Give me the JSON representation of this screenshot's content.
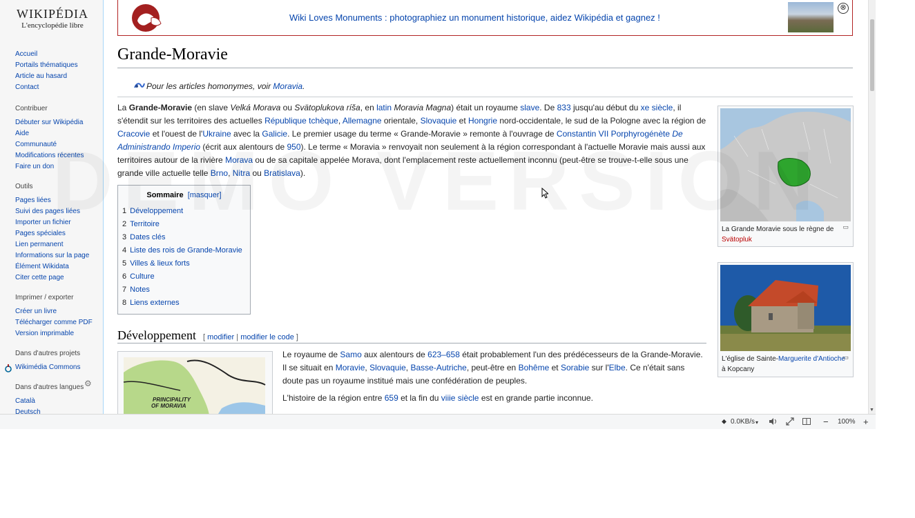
{
  "sidebar": {
    "logo_title": "WIKIPÉDIA",
    "logo_subtitle": "L'encyclopédie libre",
    "nav": [
      "Accueil",
      "Portails thématiques",
      "Article au hasard",
      "Contact"
    ],
    "contribuer": {
      "heading": "Contribuer",
      "items": [
        "Débuter sur Wikipédia",
        "Aide",
        "Communauté",
        "Modifications récentes",
        "Faire un don"
      ]
    },
    "outils": {
      "heading": "Outils",
      "items": [
        "Pages liées",
        "Suivi des pages liées",
        "Importer un fichier",
        "Pages spéciales",
        "Lien permanent",
        "Informations sur la page",
        "Élément Wikidata",
        "Citer cette page"
      ]
    },
    "imprimer": {
      "heading": "Imprimer / exporter",
      "items": [
        "Créer un livre",
        "Télécharger comme PDF",
        "Version imprimable"
      ]
    },
    "projets": {
      "heading": "Dans d'autres projets",
      "items": [
        "Wikimédia Commons"
      ]
    },
    "langues": {
      "heading": "Dans d'autres langues",
      "items": [
        "Català",
        "Deutsch"
      ]
    }
  },
  "banner": {
    "text": "Wiki Loves Monuments : photographiez un monument historique, aidez Wikipédia et gagnez !",
    "close": "⊗"
  },
  "article": {
    "title": "Grande-Moravie",
    "homonym_prefix": "Pour les articles homonymes, voir ",
    "homonym_link": "Moravia",
    "homonym_suffix": "."
  },
  "intro": {
    "t1": "La ",
    "b1": "Grande-Moravie",
    "t2": " (en slave ",
    "i1": "Velká Morava",
    "t3": " ou ",
    "i2": "Svätoplukova ríša",
    "t4": ", en ",
    "l1": "latin",
    "t5": " ",
    "i3": "Moravia Magna",
    "t6": ") était un royaume ",
    "l2": "slave",
    "t7": ". De ",
    "l3": "833",
    "t8": " jusqu'au début du ",
    "l4": "xe siècle",
    "t9": ", il s'étendit sur les territoires des actuelles ",
    "l5": "République tchèque",
    "t10": ", ",
    "l6": "Allemagne",
    "t11": " orientale, ",
    "l7": "Slovaquie",
    "t12": " et ",
    "l8": "Hongrie",
    "t13": " nord-occidentale, le sud de la Pologne avec la région de ",
    "l9": "Cracovie",
    "t14": " et l'ouest de l'",
    "l10": "Ukraine",
    "t15": " avec la ",
    "l11": "Galicie",
    "t16": ". Le premier usage du terme « Grande-Moravie » remonte à l'ouvrage de ",
    "l12": "Constantin VII Porphyrogénète",
    "t17": " ",
    "l13": "De Administrando Imperio",
    "t18": " (écrit aux alentours de ",
    "l14": "950",
    "t19": "). Le terme « Moravia » renvoyait non seulement à la région correspondant à l'actuelle Moravie mais aussi aux territoires autour de la rivière ",
    "l15": "Morava",
    "t20": " ou de sa capitale appelée Morava, dont l'emplacement reste actuellement inconnu (peut-être se trouve-t-elle sous une grande ville actuelle telle ",
    "l16": "Brno",
    "t21": ", ",
    "l17": "Nitra",
    "t22": " ou ",
    "l18": "Bratislava",
    "t23": ")."
  },
  "toc": {
    "title": "Sommaire",
    "toggle": "[masquer]",
    "items": [
      {
        "n": "1",
        "label": "Développement"
      },
      {
        "n": "2",
        "label": "Territoire"
      },
      {
        "n": "3",
        "label": "Dates clés"
      },
      {
        "n": "4",
        "label": "Liste des rois de Grande-Moravie"
      },
      {
        "n": "5",
        "label": "Villes & lieux forts"
      },
      {
        "n": "6",
        "label": "Culture"
      },
      {
        "n": "7",
        "label": "Notes"
      },
      {
        "n": "8",
        "label": "Liens externes"
      }
    ]
  },
  "section": {
    "title": "Développement",
    "edit_open": "[ ",
    "edit1": "modifier",
    "edit_sep": " | ",
    "edit2": "modifier le code",
    "edit_close": " ]"
  },
  "dev": {
    "p1_t1": "Le royaume de ",
    "p1_l1": "Samo",
    "p1_t2": " aux alentours de ",
    "p1_l2": "623–658",
    "p1_t3": " était probablement l'un des prédécesseurs de la Grande-Moravie. Il se situait en ",
    "p1_l3": "Moravie",
    "p1_t4": ", ",
    "p1_l4": "Slovaquie",
    "p1_t5": ", ",
    "p1_l5": "Basse-Autriche",
    "p1_t6": ", peut-être en ",
    "p1_l6": "Bohême",
    "p1_t7": " et ",
    "p1_l7": "Sorabie",
    "p1_t8": " sur l'",
    "p1_l8": "Elbe",
    "p1_t9": ". Ce n'était sans doute pas un royaume institué mais une confédération de peuples.",
    "p2_t1": "L'histoire de la région entre ",
    "p2_l1": "659",
    "p2_t2": " et la fin du ",
    "p2_l2": "viiie siècle",
    "p2_t3": " est en grande partie inconnue."
  },
  "map_thumb": {
    "label_line1": "PRINCIPALITY",
    "label_line2": "OF MORAVIA"
  },
  "infobox": {
    "map_caption_t": "La Grande Moravie sous le règne de ",
    "map_caption_l": "Svätopluk",
    "church_caption_t1": "L'église de Sainte-",
    "church_caption_l1": "Marguerite d'Antioche",
    "church_caption_t2": " à Kopcany"
  },
  "statusbar": {
    "speed": "0.0KB/s",
    "zoom_minus": "−",
    "zoom": "100%",
    "zoom_plus": "+"
  },
  "watermark": "DEMO VERSION",
  "colors": {
    "link": "#0645ad",
    "redlink": "#ba0000",
    "sidebar_bg": "#f6f6f6",
    "banner_border": "#b22222",
    "map_green": "#2ea52e"
  }
}
